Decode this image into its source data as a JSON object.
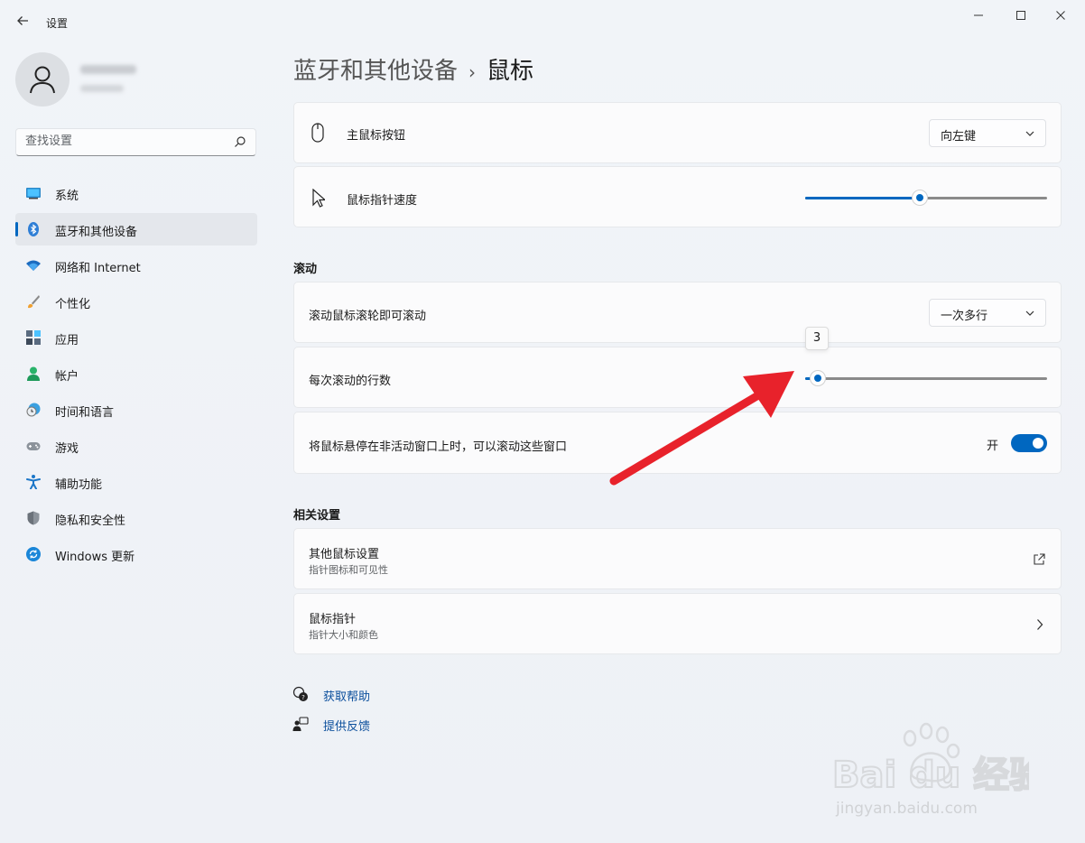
{
  "window": {
    "title": "设置",
    "controls": {
      "minimize": "—",
      "maximize": "□",
      "close": "✕"
    }
  },
  "colors": {
    "accent": "#0067c0",
    "annotation_arrow": "#e8222b"
  },
  "user": {
    "name_blurred": true
  },
  "search": {
    "placeholder": "查找设置"
  },
  "sidebar": {
    "items": [
      {
        "label": "系统",
        "icon": "monitor-icon",
        "active": false
      },
      {
        "label": "蓝牙和其他设备",
        "icon": "bluetooth-icon",
        "active": true
      },
      {
        "label": "网络和 Internet",
        "icon": "wifi-icon",
        "active": false
      },
      {
        "label": "个性化",
        "icon": "brush-icon",
        "active": false
      },
      {
        "label": "应用",
        "icon": "apps-icon",
        "active": false
      },
      {
        "label": "帐户",
        "icon": "account-icon",
        "active": false
      },
      {
        "label": "时间和语言",
        "icon": "clock-globe-icon",
        "active": false
      },
      {
        "label": "游戏",
        "icon": "gamepad-icon",
        "active": false
      },
      {
        "label": "辅助功能",
        "icon": "accessibility-icon",
        "active": false
      },
      {
        "label": "隐私和安全性",
        "icon": "shield-icon",
        "active": false
      },
      {
        "label": "Windows 更新",
        "icon": "update-icon",
        "active": false
      }
    ]
  },
  "breadcrumb": {
    "parent": "蓝牙和其他设备",
    "separator": "›",
    "current": "鼠标"
  },
  "main": {
    "primary_button": {
      "label": "主鼠标按钮",
      "value": "向左键"
    },
    "pointer_speed": {
      "label": "鼠标指针速度",
      "value_fraction": 0.47
    },
    "scroll_section": {
      "title": "滚动"
    },
    "scroll_mode": {
      "label": "滚动鼠标滚轮即可滚动",
      "value": "一次多行"
    },
    "lines_per_scroll": {
      "label": "每次滚动的行数",
      "value": 3,
      "tooltip": "3",
      "value_fraction": 0.02
    },
    "inactive_scroll": {
      "label": "将鼠标悬停在非活动窗口上时，可以滚动这些窗口",
      "state_label": "开",
      "on": true
    },
    "related_section": {
      "title": "相关设置"
    },
    "other_mouse": {
      "label": "其他鼠标设置",
      "sub": "指针图标和可见性"
    },
    "mouse_pointer": {
      "label": "鼠标指针",
      "sub": "指针大小和颜色"
    }
  },
  "help": {
    "get_help": "获取帮助",
    "feedback": "提供反馈"
  },
  "watermark": {
    "brand": "Bai du 经验",
    "url": "jingyan.baidu.com"
  }
}
